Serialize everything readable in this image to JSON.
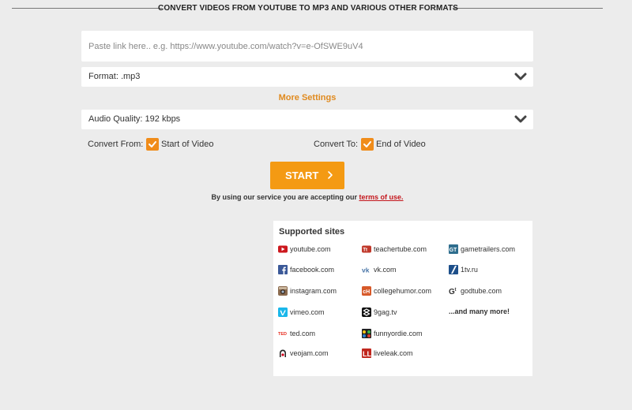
{
  "header": {
    "title": "CONVERT VIDEOS FROM YOUTUBE TO MP3 AND VARIOUS OTHER FORMATS"
  },
  "url_input": {
    "placeholder": "Paste link here.. e.g. https://www.youtube.com/watch?v=e-OfSWE9uV4",
    "value": ""
  },
  "format_select": {
    "label": "Format: .mp3"
  },
  "more_settings": "More Settings",
  "quality_select": {
    "label": "Audio Quality: 192 kbps"
  },
  "convert_from": {
    "label": "Convert From:",
    "option": "Start of Video",
    "checked": true
  },
  "convert_to": {
    "label": "Convert To:",
    "option": "End of Video",
    "checked": true
  },
  "start_button": {
    "label": "START"
  },
  "terms": {
    "text": "By using our service you are accepting our ",
    "link": "terms of use."
  },
  "supported": {
    "title": "Supported sites",
    "col1": [
      "youtube.com",
      "facebook.com",
      "instagram.com",
      "vimeo.com",
      "ted.com",
      "veojam.com"
    ],
    "col2": [
      "teachertube.com",
      "vk.com",
      "collegehumor.com",
      "9gag.tv",
      "funnyordie.com",
      "liveleak.com"
    ],
    "col3": [
      "gametrailers.com",
      "1tv.ru",
      "godtube.com"
    ],
    "more": "...and many more!"
  },
  "colors": {
    "accent": "#f49a13",
    "link": "#c4161c",
    "background": "#ececec"
  }
}
